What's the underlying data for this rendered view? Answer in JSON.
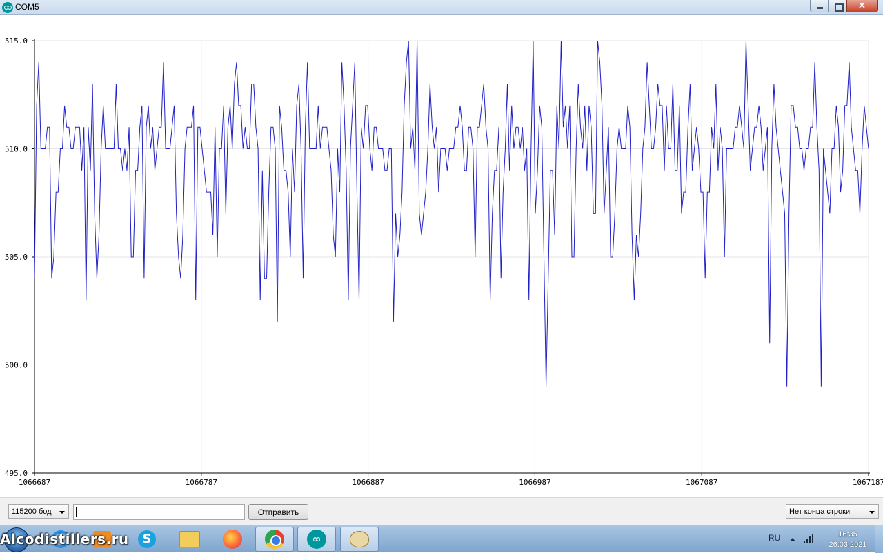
{
  "window": {
    "title": "COM5"
  },
  "chart_data": {
    "type": "line",
    "title": "",
    "xlabel": "",
    "ylabel": "",
    "ylim": [
      495,
      515
    ],
    "xlim": [
      1066687,
      1067187
    ],
    "y_ticks": [
      "515.0",
      "510.0",
      "505.0",
      "500.0",
      "495.0"
    ],
    "x_ticks": [
      "1066687",
      "1066787",
      "1066887",
      "1066987",
      "1067087",
      "1067187"
    ],
    "grid": true,
    "series": [
      {
        "color": "#2020c8",
        "values": [
          504,
          512,
          514,
          510,
          510,
          510,
          511,
          511,
          504,
          505,
          508,
          508,
          510,
          510,
          512,
          511,
          511,
          510,
          510,
          511,
          511,
          511,
          509,
          511,
          503,
          511,
          509,
          513,
          507,
          504,
          506,
          510,
          512,
          510,
          510,
          510,
          510,
          510,
          513,
          510,
          510,
          509,
          510,
          509,
          511,
          505,
          505,
          509,
          509,
          511,
          512,
          504,
          511,
          512,
          510,
          511,
          509,
          510,
          511,
          511,
          514,
          510,
          510,
          510,
          511,
          512,
          507,
          505,
          504,
          506,
          510,
          511,
          511,
          511,
          512,
          503,
          511,
          511,
          510,
          509,
          508,
          508,
          508,
          506,
          511,
          505,
          510,
          510,
          512,
          507,
          511,
          512,
          510,
          513,
          514,
          512,
          512,
          510,
          511,
          510,
          510,
          513,
          513,
          511,
          510,
          503,
          509,
          504,
          504,
          508,
          511,
          511,
          510,
          502,
          512,
          511,
          509,
          509,
          508,
          505,
          510,
          508,
          512,
          513,
          510,
          504,
          511,
          514,
          510,
          510,
          510,
          510,
          512,
          510,
          511,
          511,
          511,
          510,
          509,
          506,
          505,
          510,
          508,
          514,
          512,
          509,
          503,
          510,
          512,
          514,
          508,
          503,
          511,
          510,
          512,
          512,
          510,
          509,
          511,
          511,
          510,
          510,
          510,
          509,
          509,
          510,
          510,
          502,
          507,
          505,
          506,
          508,
          512,
          514,
          515,
          510,
          511,
          509,
          515,
          507,
          506,
          507,
          508,
          510,
          513,
          511,
          510,
          511,
          508,
          510,
          510,
          510,
          509,
          510,
          510,
          510,
          511,
          511,
          512,
          511,
          509,
          509,
          511,
          511,
          510,
          505,
          511,
          511,
          512,
          513,
          511,
          510,
          503,
          507,
          509,
          509,
          511,
          504,
          508,
          510,
          513,
          509,
          512,
          510,
          511,
          511,
          510,
          511,
          509,
          510,
          503,
          510,
          515,
          507,
          509,
          512,
          511,
          505,
          499,
          504,
          509,
          509,
          506,
          512,
          510,
          515,
          511,
          512,
          510,
          512,
          505,
          505,
          510,
          513,
          511,
          510,
          512,
          509,
          512,
          511,
          507,
          507,
          515,
          514,
          512,
          507,
          509,
          511,
          505,
          505,
          507,
          510,
          511,
          510,
          510,
          510,
          512,
          511,
          506,
          503,
          506,
          505,
          507,
          510,
          511,
          514,
          512,
          510,
          510,
          511,
          513,
          512,
          512,
          509,
          512,
          510,
          510,
          513,
          509,
          509,
          512,
          507,
          508,
          508,
          511,
          513,
          509,
          510,
          511,
          510,
          508,
          508,
          504,
          508,
          508,
          511,
          510,
          513,
          509,
          511,
          510,
          505,
          510,
          510,
          510,
          510,
          511,
          511,
          512,
          511,
          510,
          515,
          512,
          509,
          510,
          511,
          511,
          512,
          511,
          509,
          510,
          511,
          501,
          510,
          513,
          511,
          510,
          509,
          508,
          507,
          499,
          507,
          512,
          512,
          511,
          511,
          510,
          510,
          509,
          510,
          510,
          511,
          511,
          514,
          511,
          509,
          499,
          510,
          509,
          508,
          507,
          510,
          510,
          512,
          511,
          508,
          509,
          512,
          512,
          514,
          511,
          510,
          509,
          509,
          507,
          510,
          512,
          511,
          510
        ]
      }
    ]
  },
  "controls": {
    "baud_rate": "115200 бод",
    "send_input_value": "",
    "send_button": "Отправить",
    "line_ending": "Нет конца строки"
  },
  "taskbar": {
    "watermark": "Alcodistillers.ru",
    "icons": [
      "windows-start-icon",
      "ie-icon",
      "media-player-icon",
      "skype-icon",
      "folder-icon",
      "firefox-icon",
      "chrome-icon",
      "arduino-icon",
      "paint-icon"
    ],
    "skype_glyph": "S",
    "arduino_glyph": "∞",
    "language": "RU",
    "time": "16:35",
    "date": "26.03.2021"
  }
}
